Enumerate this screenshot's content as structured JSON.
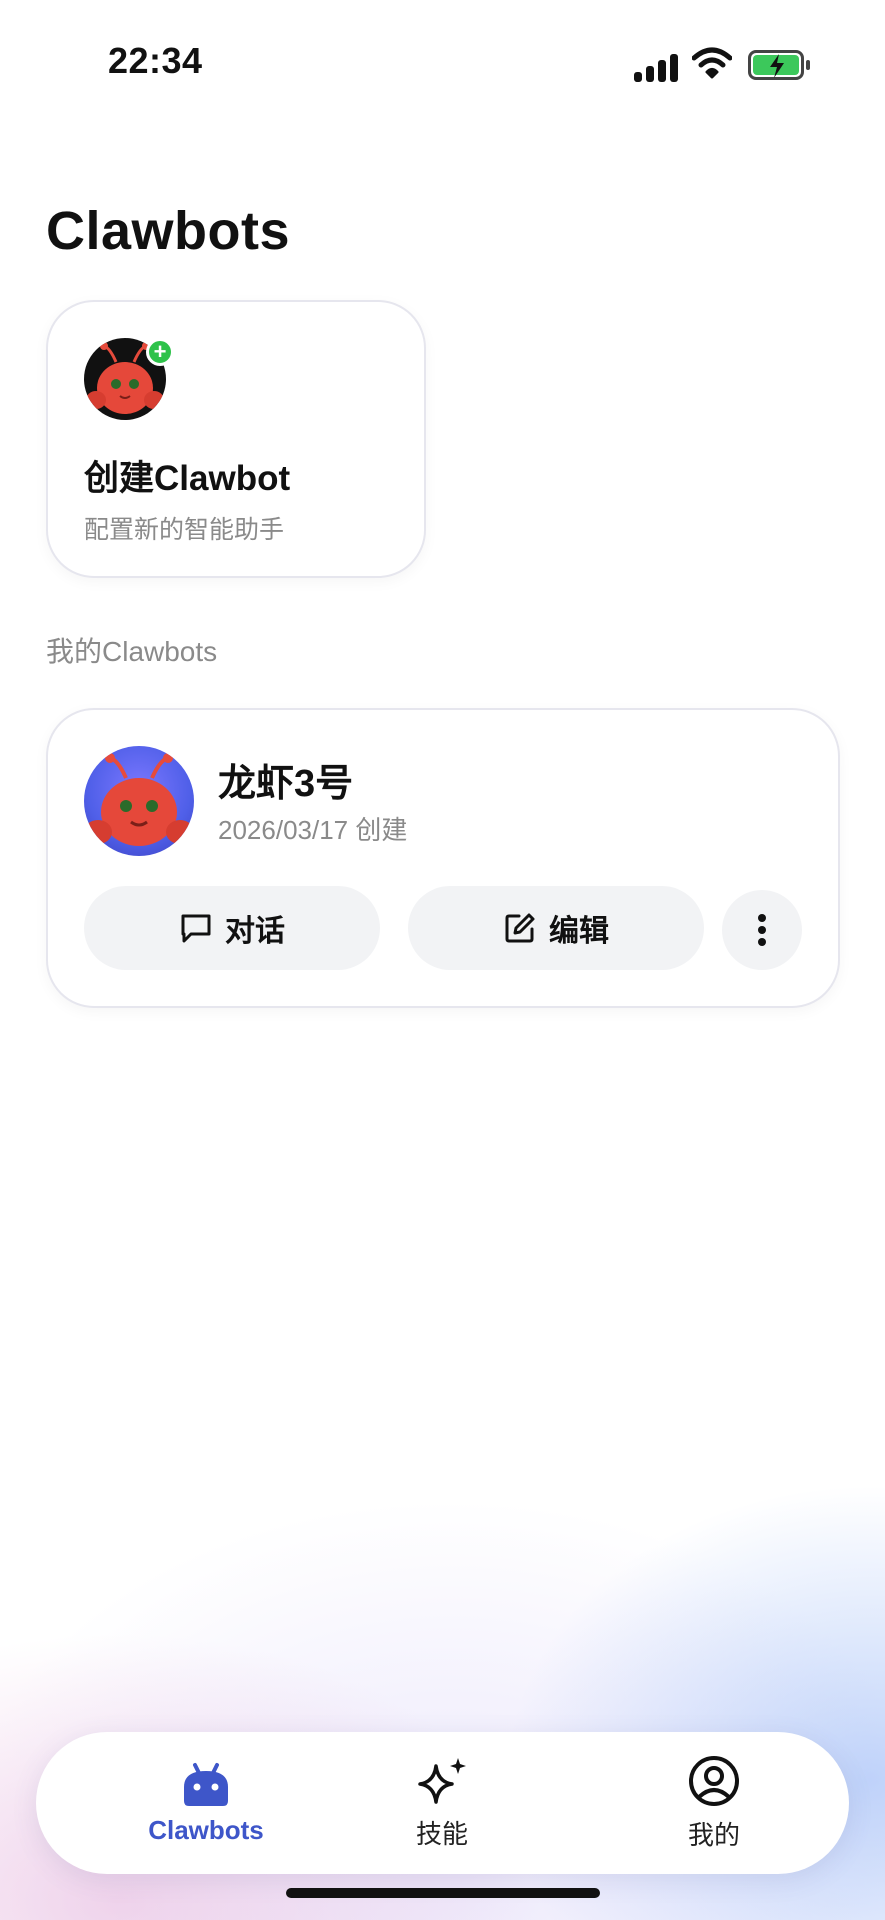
{
  "status_bar": {
    "time": "22:34"
  },
  "page": {
    "title": "Clawbots"
  },
  "create_card": {
    "title": "创建Clawbot",
    "subtitle": "配置新的智能助手",
    "badge": "+"
  },
  "section": {
    "label": "我的Clawbots"
  },
  "bot": {
    "name": "龙虾3号",
    "created": "2026/03/17 创建",
    "chat_label": "对话",
    "edit_label": "编辑"
  },
  "tabs": [
    {
      "label": "Clawbots",
      "icon": "android-robot-icon",
      "active": true
    },
    {
      "label": "技能",
      "icon": "sparkle-icon",
      "active": false
    },
    {
      "label": "我的",
      "icon": "user-circle-icon",
      "active": false
    }
  ],
  "colors": {
    "accent": "#3e56c9",
    "badge_green": "#2ec24a",
    "battery_green": "#3cc85b"
  }
}
